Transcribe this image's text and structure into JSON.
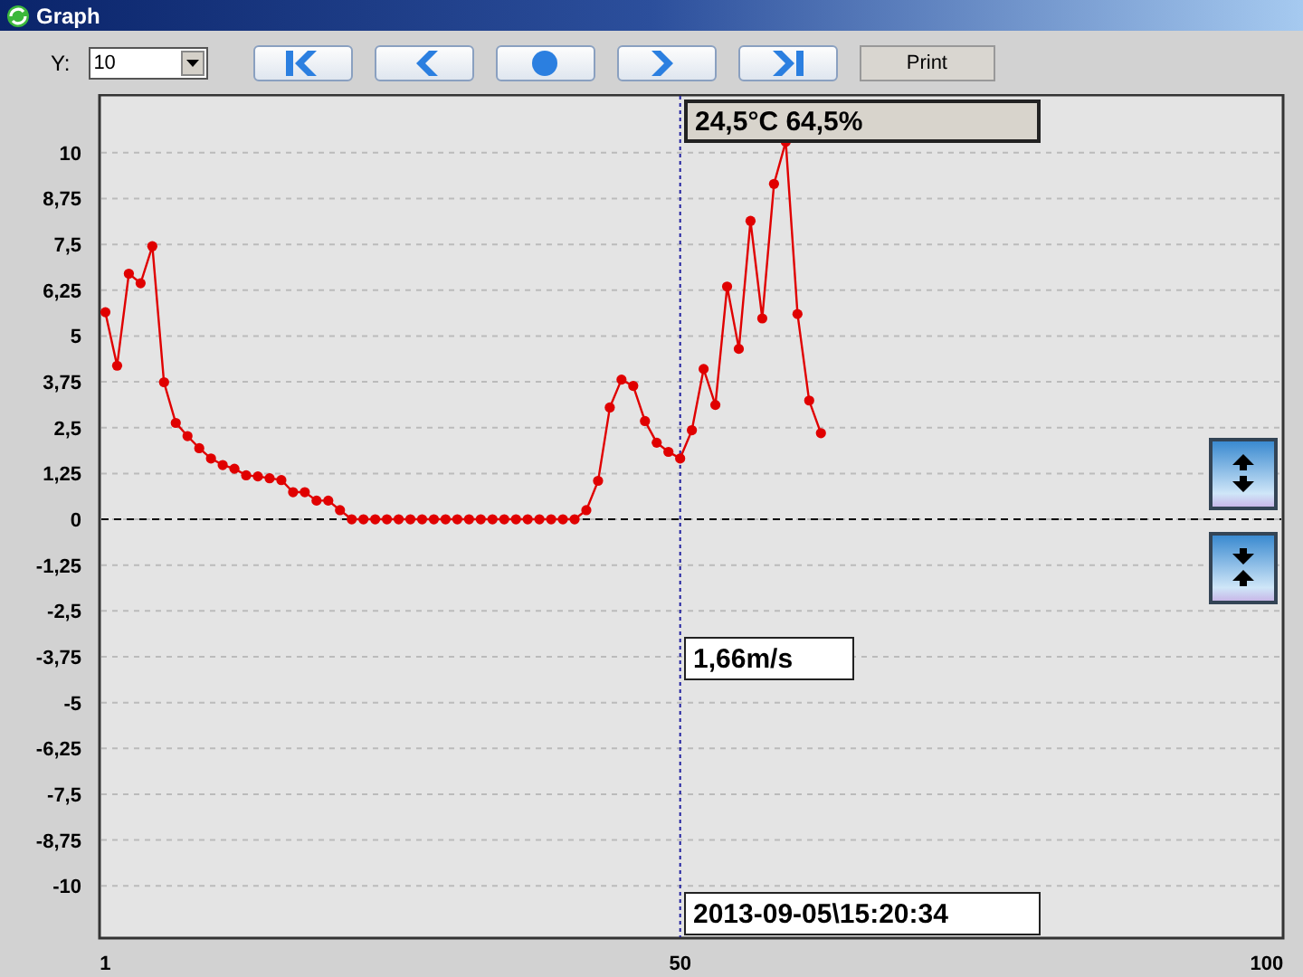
{
  "window": {
    "title": "Graph"
  },
  "toolbar": {
    "y_label": "Y:",
    "y_select": "10",
    "nav_buttons": [
      {
        "kind": "first"
      },
      {
        "kind": "previous"
      },
      {
        "kind": "center"
      },
      {
        "kind": "next"
      },
      {
        "kind": "last"
      }
    ],
    "print_button": "Print"
  },
  "graph": {
    "readout_top": "24,5°C 64,5%",
    "readout_value": "1,66m/s",
    "readout_time": "2013-09-05\\15:20:34",
    "side_buttons": [
      {
        "kind": "expand"
      },
      {
        "kind": "compress"
      }
    ],
    "chart_data": {
      "type": "line",
      "x": [
        1,
        2,
        3,
        4,
        5,
        6,
        7,
        8,
        9,
        10,
        11,
        12,
        13,
        14,
        15,
        16,
        17,
        18,
        19,
        20,
        21,
        22,
        23,
        24,
        25,
        26,
        27,
        28,
        29,
        30,
        31,
        32,
        33,
        34,
        35,
        36,
        37,
        38,
        39,
        40,
        41,
        42,
        43,
        44,
        45,
        46,
        47,
        48,
        49,
        50,
        51,
        52,
        53,
        54,
        55,
        56,
        57,
        58,
        59,
        60,
        61,
        62
      ],
      "series": [
        {
          "color": "#e00000",
          "marker": "o",
          "values": [
            5.65,
            4.19,
            6.7,
            6.44,
            7.45,
            3.74,
            2.63,
            2.27,
            1.94,
            1.66,
            1.48,
            1.38,
            1.2,
            1.17,
            1.12,
            1.07,
            0.74,
            0.74,
            0.51,
            0.51,
            0.25,
            0,
            0,
            0,
            0,
            0,
            0,
            0,
            0,
            0,
            0,
            0,
            0,
            0,
            0,
            0,
            0,
            0,
            0,
            0,
            0,
            0.25,
            1.05,
            3.05,
            3.81,
            3.64,
            2.68,
            2.09,
            1.84,
            1.66,
            2.43,
            4.1,
            3.12,
            6.35,
            4.65,
            8.14,
            5.48,
            9.15,
            10.3,
            5.6,
            3.24,
            2.35
          ]
        }
      ],
      "xlim": [
        0.5,
        101.4
      ],
      "ylim": [
        -11.4,
        11.6
      ],
      "grid": true,
      "xticks": [
        1,
        50,
        100
      ],
      "yticks": [
        {
          "value": 10,
          "label": "10"
        },
        {
          "value": 8.75,
          "label": "8,75"
        },
        {
          "value": 7.5,
          "label": "7,5"
        },
        {
          "value": 6.25,
          "label": "6,25"
        },
        {
          "value": 5,
          "label": "5"
        },
        {
          "value": 3.75,
          "label": "3,75"
        },
        {
          "value": 2.5,
          "label": "2,5"
        },
        {
          "value": 1.25,
          "label": "1,25"
        },
        {
          "value": 0,
          "label": "0"
        },
        {
          "value": -1.25,
          "label": "-1,25"
        },
        {
          "value": -2.5,
          "label": "-2,5"
        },
        {
          "value": -3.75,
          "label": "-3,75"
        },
        {
          "value": -5,
          "label": "-5"
        },
        {
          "value": -6.25,
          "label": "-6,25"
        },
        {
          "value": -7.5,
          "label": "-7,5"
        },
        {
          "value": -8.75,
          "label": "-8,75"
        },
        {
          "value": -10,
          "label": "-10"
        }
      ],
      "ref_lines": [
        {
          "axis": "y",
          "value": 0
        },
        {
          "axis": "x",
          "value": 50
        }
      ]
    }
  }
}
